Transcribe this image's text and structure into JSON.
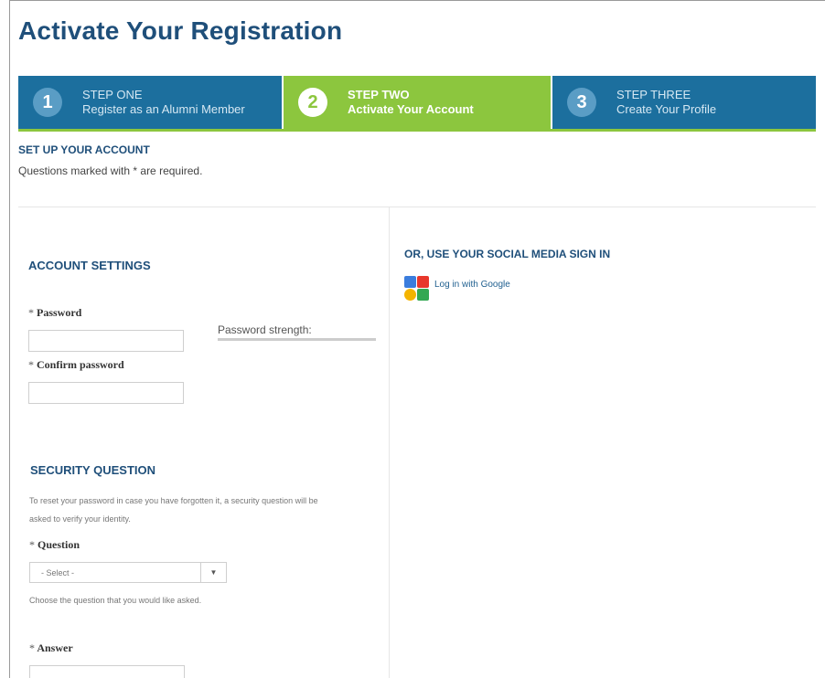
{
  "page": {
    "title": "Activate Your Registration"
  },
  "steps": [
    {
      "number": "1",
      "label": "STEP ONE",
      "description": "Register as an Alumni Member",
      "state": "done"
    },
    {
      "number": "2",
      "label": "STEP TWO",
      "description": "Activate Your Account",
      "state": "active"
    },
    {
      "number": "3",
      "label": "STEP THREE",
      "description": "Create Your Profile",
      "state": "upcoming"
    }
  ],
  "setup": {
    "title": "SET UP YOUR ACCOUNT",
    "required_note": "Questions marked with * are required."
  },
  "account_settings": {
    "title": "ACCOUNT SETTINGS",
    "password_label": "Password",
    "password_value": "",
    "confirm_label": "Confirm password",
    "confirm_value": "",
    "strength_label": "Password strength:"
  },
  "security": {
    "title": "SECURITY QUESTION",
    "help_line1": "To reset your password in case you have forgotten it, a security question will be",
    "help_line2": "asked to verify your identity.",
    "question_label": "Question",
    "question_selected": "- Select -",
    "question_help": "Choose the question that you would like asked.",
    "answer_label": "Answer",
    "answer_value": ""
  },
  "social": {
    "title": "OR, USE YOUR SOCIAL MEDIA SIGN IN",
    "google_label": "Log in with Google"
  },
  "required_marker": "*",
  "colors": {
    "brand_blue": "#1c6f9e",
    "active_green": "#8cc63e",
    "heading_navy": "#1f4f7a"
  }
}
